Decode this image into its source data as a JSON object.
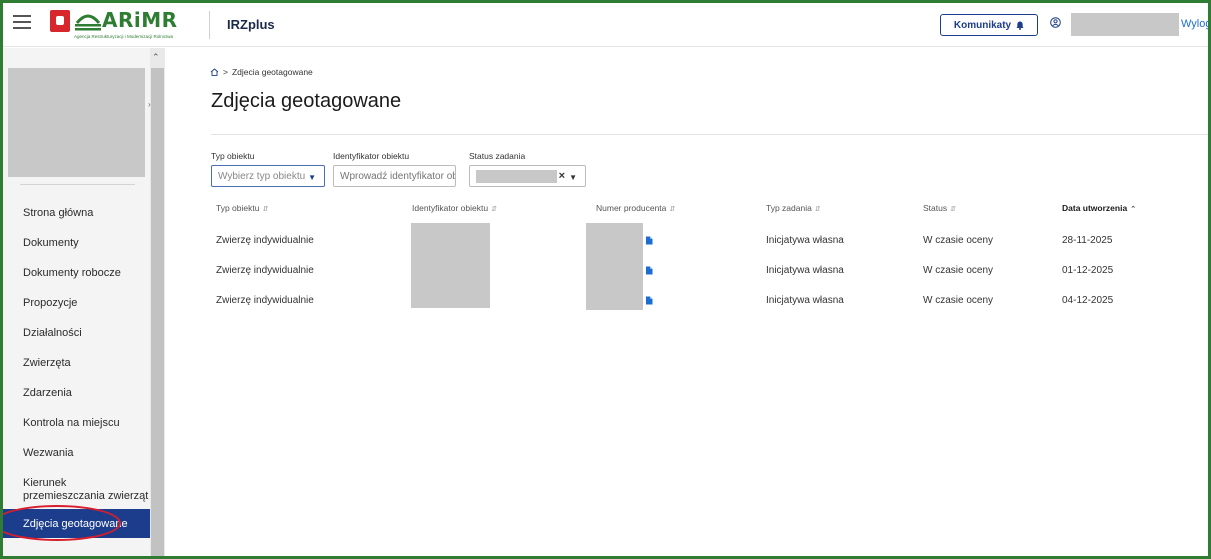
{
  "header": {
    "logo_text": "ARiMR",
    "logo_tagline": "Agencja Restrukturyzacji i Modernizacji Rolnictwa",
    "app_title": "IRZplus",
    "komunikaty_label": "Komunikaty",
    "logout_label": "Wyloguj"
  },
  "sidebar": {
    "items": [
      {
        "label": "Strona główna"
      },
      {
        "label": "Dokumenty"
      },
      {
        "label": "Dokumenty robocze"
      },
      {
        "label": "Propozycje"
      },
      {
        "label": "Działalności"
      },
      {
        "label": "Zwierzęta"
      },
      {
        "label": "Zdarzenia"
      },
      {
        "label": "Kontrola na miejscu"
      },
      {
        "label": "Wezwania"
      },
      {
        "label": "Kierunek przemieszczania zwierząt"
      },
      {
        "label": "Zdjęcia geotagowane",
        "active": true
      }
    ]
  },
  "breadcrumb": {
    "current": "Zdjecia geotagowane"
  },
  "page_title": "Zdjęcia geotagowane",
  "filters": {
    "typ_label": "Typ obiektu",
    "typ_placeholder": "Wybierz typ obiektu",
    "ident_label": "Identyfikator obiektu",
    "ident_placeholder": "Wprowadź identyfikator ob",
    "status_label": "Status zadania"
  },
  "table": {
    "columns": [
      {
        "label": "Typ obiektu",
        "sorted": false
      },
      {
        "label": "Identyfikator obiektu",
        "sorted": false
      },
      {
        "label": "Numer producenta",
        "sorted": false
      },
      {
        "label": "Typ zadania",
        "sorted": false
      },
      {
        "label": "Status",
        "sorted": false
      },
      {
        "label": "Data utworzenia",
        "sorted": true
      }
    ],
    "rows": [
      {
        "typ_obiektu": "Zwierzę indywidualnie",
        "typ_zadania": "Inicjatywa własna",
        "status": "W czasie oceny",
        "data": "28-11-2025"
      },
      {
        "typ_obiektu": "Zwierzę indywidualnie",
        "typ_zadania": "Inicjatywa własna",
        "status": "W czasie oceny",
        "data": "01-12-2025"
      },
      {
        "typ_obiektu": "Zwierzę indywidualnie",
        "typ_zadania": "Inicjatywa własna",
        "status": "W czasie oceny",
        "data": "04-12-2025"
      }
    ]
  },
  "colors": {
    "brand_green": "#2e7d32",
    "nav_active": "#1c3d8c",
    "highlight_ring": "#d81e2c",
    "link": "#1c6dd0"
  },
  "icons": [
    "menu-icon",
    "poland-emblem-icon",
    "home-icon",
    "bell-icon",
    "user-circle-icon",
    "chevron-up-icon",
    "chevron-down-icon",
    "clear-icon",
    "sort-icon",
    "document-icon"
  ]
}
